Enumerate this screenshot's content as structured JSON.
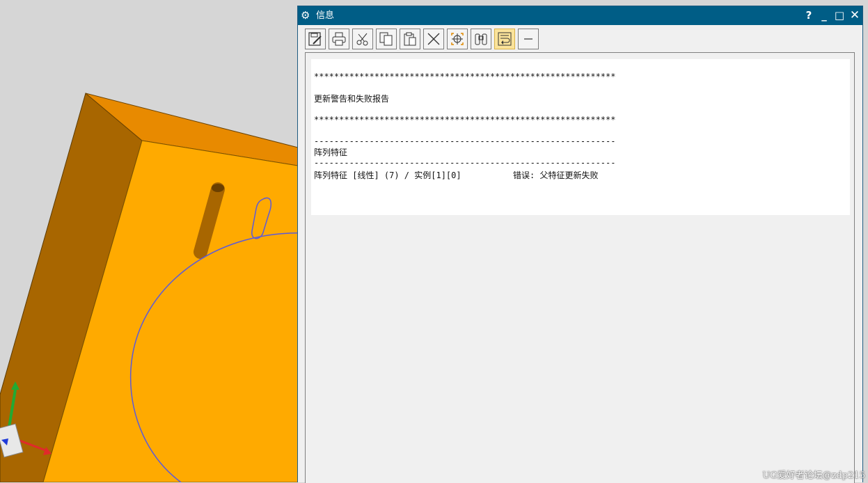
{
  "window": {
    "title": "信息",
    "help_glyph": "?",
    "minimize_glyph": "_",
    "maximize_glyph": "□",
    "close_glyph": "✕"
  },
  "toolbar": {
    "buttons": [
      {
        "name": "save-as-text-button",
        "icon": "save-edit-icon"
      },
      {
        "name": "print-button",
        "icon": "printer-icon"
      },
      {
        "name": "cut-button",
        "icon": "scissors-icon"
      },
      {
        "name": "copy-button",
        "icon": "copy-icon"
      },
      {
        "name": "paste-button",
        "icon": "paste-icon"
      },
      {
        "name": "delete-button",
        "icon": "x-icon"
      },
      {
        "name": "identify-button",
        "icon": "crosshair-icon"
      },
      {
        "name": "find-button",
        "icon": "binoculars-icon"
      },
      {
        "name": "word-wrap-button",
        "icon": "wrap-icon",
        "active": true
      },
      {
        "name": "collapse-button",
        "icon": "minus-icon"
      }
    ]
  },
  "report": {
    "stars_top": "************************************************************",
    "heading": "更新警告和失败报告",
    "stars_bottom": "************************************************************",
    "dash_top": "------------------------------------------------------------",
    "section": "阵列特征",
    "dash_bottom": "------------------------------------------------------------",
    "entry_feature": "阵列特征 [线性] (7) / 实例[1][0]",
    "entry_error": "错误: 父特征更新失败"
  },
  "watermark": "UG爱好者论坛@zdp215",
  "colors": {
    "title_bar": "#005d86",
    "model_face_front": "#ffaa00",
    "model_face_side": "#a86600",
    "model_face_top": "#e88a00",
    "curve": "#5a5adc",
    "toolbar_active": "#fbe39a"
  }
}
